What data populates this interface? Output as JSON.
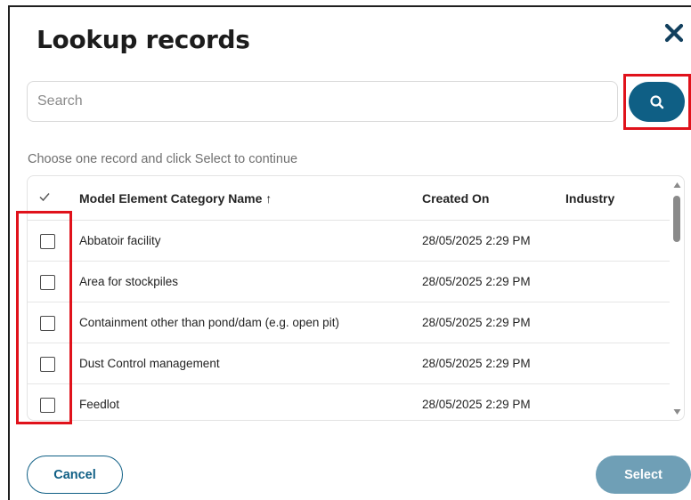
{
  "dialog": {
    "title": "Lookup records",
    "close_icon": "close-x-icon"
  },
  "search": {
    "placeholder": "Search",
    "value": "",
    "button_icon": "search-icon",
    "button_color": "#0f5f85"
  },
  "hint": "Choose one record and click Select to continue",
  "grid": {
    "columns": [
      "Model Element Category Name",
      "Created On",
      "Industry"
    ],
    "sort_indicator": "↑",
    "select_all_icon": "checkmark-icon",
    "rows": [
      {
        "name": "Abbatoir facility",
        "created_on": "28/05/2025 2:29 PM",
        "industry": "",
        "checked": false
      },
      {
        "name": "Area for stockpiles",
        "created_on": "28/05/2025 2:29 PM",
        "industry": "",
        "checked": false
      },
      {
        "name": "Containment other than pond/dam (e.g. open pit)",
        "created_on": "28/05/2025 2:29 PM",
        "industry": "",
        "checked": false
      },
      {
        "name": "Dust Control management",
        "created_on": "28/05/2025 2:29 PM",
        "industry": "",
        "checked": false
      },
      {
        "name": "Feedlot",
        "created_on": "28/05/2025 2:29 PM",
        "industry": "",
        "checked": false
      }
    ]
  },
  "footer": {
    "cancel_label": "Cancel",
    "select_label": "Select",
    "select_enabled": false
  },
  "colors": {
    "primary": "#0f5f85",
    "primary_disabled": "#6f9fb6",
    "highlight": "#e0121b"
  }
}
